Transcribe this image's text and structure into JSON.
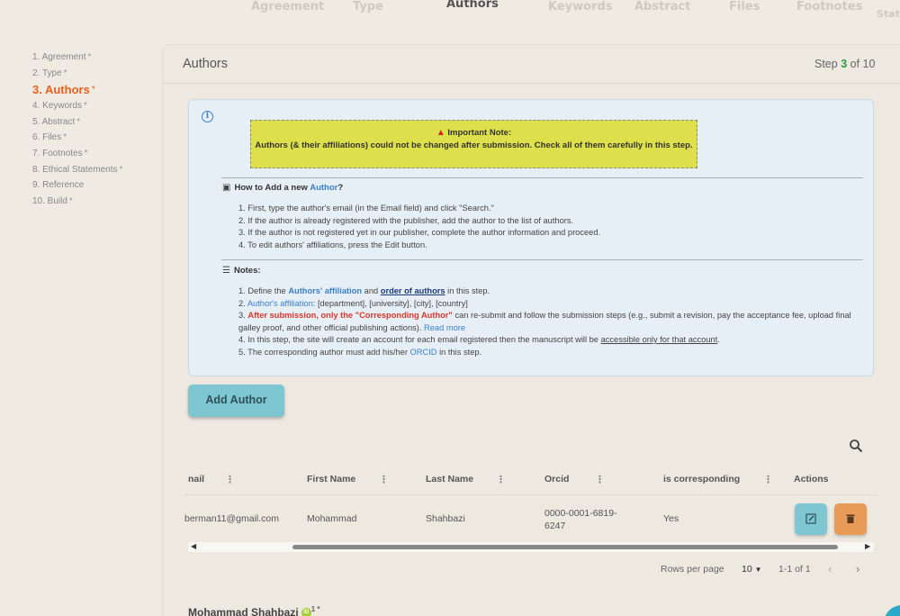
{
  "topnav": {
    "steps": [
      "Agreement",
      "Type",
      "Authors",
      "Keywords",
      "Abstract",
      "Files",
      "Footnotes",
      "Stat"
    ],
    "active": "Authors"
  },
  "sidebar": {
    "items": [
      {
        "label": "1. Agreement",
        "star": "*"
      },
      {
        "label": "2. Type",
        "star": "*"
      },
      {
        "label": "3. Authors",
        "star": "*"
      },
      {
        "label": "4. Keywords",
        "star": "*"
      },
      {
        "label": "5. Abstract",
        "star": "*"
      },
      {
        "label": "6. Files",
        "star": "*"
      },
      {
        "label": "7. Footnotes",
        "star": "*"
      },
      {
        "label": "8. Ethical Statements",
        "star": "*"
      },
      {
        "label": "9. Reference",
        "star": ""
      },
      {
        "label": "10. Build",
        "star": "*"
      }
    ]
  },
  "card": {
    "title": "Authors",
    "step_prefix": "Step",
    "step_current": "3",
    "step_of": "of 10"
  },
  "note": {
    "title": "Important Note:",
    "body": "Authors (& their affiliations) could not be changed after submission. Check all of them carefully in this step."
  },
  "howto": {
    "title_prefix": "How to Add a new",
    "title_link": "Author",
    "title_suffix": "?",
    "items": [
      "1. First, type the author's email (in the Email field) and click \"Search.\"",
      "2. If the author is already registered with the publisher, add the author to the list of authors.",
      "3. If the author is not registered yet in our publisher, complete the author information and proceed.",
      "4. To edit authors' affiliations, press the Edit button."
    ]
  },
  "notes": {
    "title": "Notes:",
    "n1_a": "1. Define the",
    "n1_b": "Authors' affiliation",
    "n1_c": "and",
    "n1_d": "order of authors",
    "n1_e": "in this step.",
    "n2_a": "2.",
    "n2_b": "Author's affiliation",
    "n2_c": ": [department], [university], [city], [country]",
    "n3_a": "3.",
    "n3_b": "After submission, only the \"Corresponding Author\"",
    "n3_c": "can re-submit and follow the submission steps (e.g., submit a revision, pay the acceptance fee, upload final galley proof, and other official publishing actions).",
    "n3_d": "Read more",
    "n4_a": "4. In this step, the site will create an account for each email registered then the manuscript will be",
    "n4_b": "accessible only for that account",
    "n4_c": ".",
    "n5_a": "5. The corresponding author must add his/her",
    "n5_b": "ORCID",
    "n5_c": "in this step."
  },
  "add_author_label": "Add Author",
  "table": {
    "headers": [
      "nail",
      "First Name",
      "Last Name",
      "Orcid",
      "is corresponding",
      "Actions"
    ],
    "row": {
      "email": "berman11@gmail.com",
      "first": "Mohammad",
      "last": "Shahbazi",
      "orcid_1": "0000-0001-6819-",
      "orcid_2": "6247",
      "corresponding": "Yes"
    }
  },
  "pager": {
    "rows_label": "Rows per page",
    "rows_value": "10",
    "range": "1-1 of 1"
  },
  "author_card": {
    "name": "Mohammad Shahbazi",
    "sup": "1 *"
  }
}
